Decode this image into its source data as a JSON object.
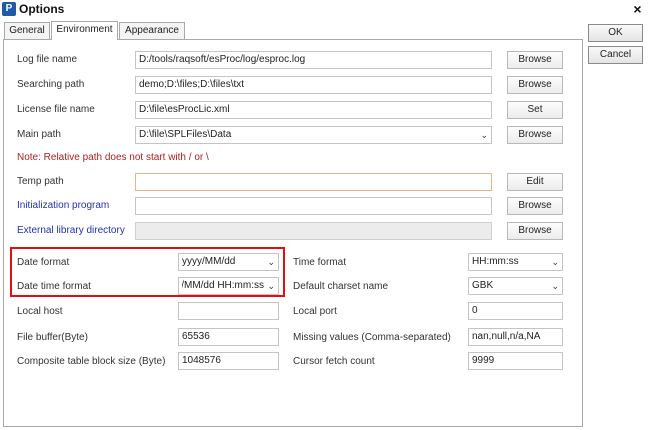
{
  "window": {
    "title": "Options",
    "icon": "P",
    "close_label": "×"
  },
  "tabs": [
    {
      "label": "General"
    },
    {
      "label": "Environment"
    },
    {
      "label": "Appearance"
    }
  ],
  "side_buttons": {
    "ok": "OK",
    "cancel": "Cancel"
  },
  "fields": {
    "log_file_name": {
      "label": "Log file name",
      "value": "D:/tools/raqsoft/esProc/log/esproc.log",
      "button": "Browse"
    },
    "searching_path": {
      "label": "Searching path",
      "value": "demo;D:\\files;D:\\files\\txt",
      "button": "Browse"
    },
    "license_file_name": {
      "label": "License file name",
      "value": "D:\\file\\esProcLic.xml",
      "button": "Set"
    },
    "main_path": {
      "label": "Main path",
      "value": "D:\\file\\SPLFiles\\Data",
      "button": "Browse"
    },
    "note": "Note: Relative path does not start with / or \\",
    "temp_path": {
      "label": "Temp path",
      "value": "",
      "button": "Edit"
    },
    "initialization_program": {
      "label": "Initialization program",
      "value": "",
      "button": "Browse"
    },
    "external_library_directory": {
      "label": "External library directory",
      "value": "",
      "button": "Browse"
    },
    "date_format": {
      "label": "Date format",
      "value": "yyyy/MM/dd"
    },
    "date_time_format": {
      "label": "Date time format",
      "value": "yyyy/MM/dd HH:mm:ss"
    },
    "time_format": {
      "label": "Time format",
      "value": "HH:mm:ss"
    },
    "default_charset": {
      "label": "Default charset name",
      "value": "GBK"
    },
    "local_host": {
      "label": "Local host",
      "value": ""
    },
    "local_port": {
      "label": "Local port",
      "value": "0"
    },
    "file_buffer": {
      "label": "File buffer(Byte)",
      "value": "65536"
    },
    "missing_values": {
      "label": "Missing values (Comma-separated)",
      "value": "nan,null,n/a,NA"
    },
    "composite_block_size": {
      "label": "Composite table block size (Byte)",
      "value": "1048576"
    },
    "cursor_fetch_count": {
      "label": "Cursor fetch count",
      "value": "9999"
    }
  },
  "colors": {
    "highlight": "#e01010",
    "note": "#b02020",
    "link_label": "#2233aa"
  }
}
